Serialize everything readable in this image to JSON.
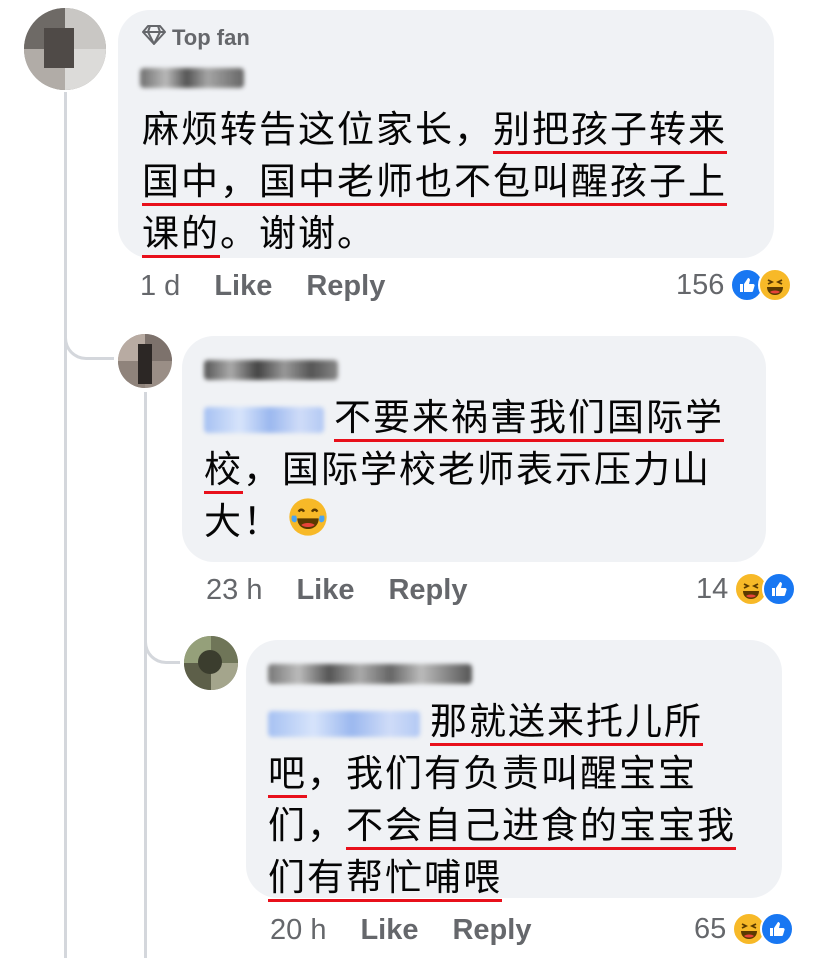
{
  "comments": [
    {
      "badge": "Top fan",
      "segments": [
        {
          "text": "麻烦转告这位家长，",
          "u": false
        },
        {
          "text": "别把孩子转来国中，国中老师也不包叫醒孩子上课的",
          "u": true
        },
        {
          "text": "。谢谢。",
          "u": false
        }
      ],
      "time": "1 d",
      "like_label": "Like",
      "reply_label": "Reply",
      "reaction_count": "156",
      "reactions": [
        "like-icon",
        "haha-icon"
      ]
    },
    {
      "segments": [
        {
          "text": "不要来祸害我们国际学校",
          "u": true
        },
        {
          "text": "，国际学校老师表示压力山大！",
          "u": false
        }
      ],
      "time": "23 h",
      "like_label": "Like",
      "reply_label": "Reply",
      "reaction_count": "14",
      "reactions": [
        "haha-icon",
        "like-icon"
      ]
    },
    {
      "segments": [
        {
          "text": "那就送来托儿所吧",
          "u": true
        },
        {
          "text": "，我们有负责叫醒宝宝们，",
          "u": false
        },
        {
          "text": "不会自己进食的宝宝我们有帮忙哺喂",
          "u": true
        }
      ],
      "time": "20 h",
      "like_label": "Like",
      "reply_label": "Reply",
      "reaction_count": "65",
      "reactions": [
        "haha-icon",
        "like-icon"
      ]
    }
  ],
  "colors": {
    "bubble": "#f0f2f5",
    "underline": "#e8101b",
    "mention": "#1877f2",
    "meta": "#65676b",
    "like": "#1877f2",
    "haha": "#f7b928"
  }
}
